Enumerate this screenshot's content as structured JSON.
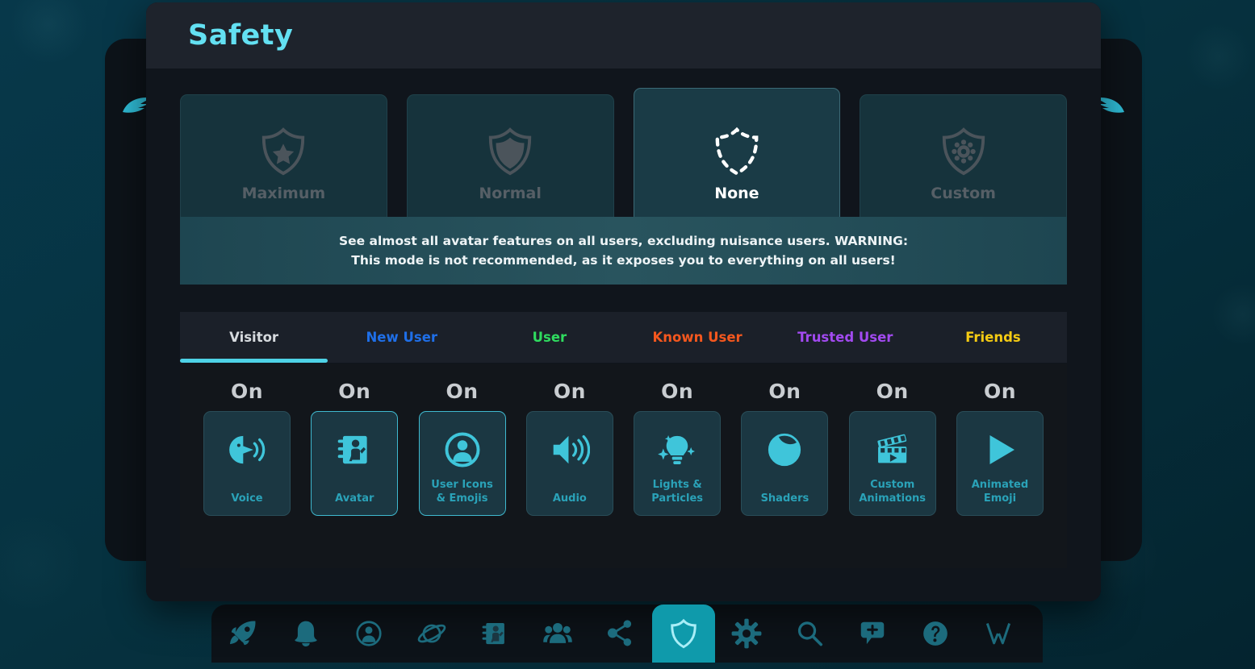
{
  "header": {
    "title": "Safety"
  },
  "colors": {
    "accent_cyan": "#63e0f2",
    "tile_icon": "#3fc5da",
    "tile_label": "#2aa2b8",
    "warning_text": "#eef4f6",
    "active_nav": "#0f9aab"
  },
  "safety_levels": [
    {
      "label": "Maximum",
      "icon": "shield-star-icon",
      "selected": false
    },
    {
      "label": "Normal",
      "icon": "shield-plain-icon",
      "selected": false
    },
    {
      "label": "None",
      "icon": "shield-dashed-icon",
      "selected": true
    },
    {
      "label": "Custom",
      "icon": "shield-gear-icon",
      "selected": false
    }
  ],
  "warning": {
    "line1": "See almost all avatar features on all users, excluding nuisance users. WARNING:",
    "line2": "This mode is not recommended, as it exposes you to everything on all users!"
  },
  "trust_tabs": [
    {
      "label": "Visitor",
      "color": "#d6dade",
      "active": true
    },
    {
      "label": "New User",
      "color": "#1f6fe8",
      "active": false
    },
    {
      "label": "User",
      "color": "#2fdb5f",
      "active": false
    },
    {
      "label": "Known User",
      "color": "#f4571e",
      "active": false
    },
    {
      "label": "Trusted User",
      "color": "#a24af0",
      "active": false
    },
    {
      "label": "Friends",
      "color": "#f5cb13",
      "active": false
    }
  ],
  "features": [
    {
      "state": "On",
      "label": "Voice",
      "icon": "voice-icon",
      "highlight": false
    },
    {
      "state": "On",
      "label": "Avatar",
      "icon": "avatar-book-icon",
      "highlight": true
    },
    {
      "state": "On",
      "label": "User Icons\n& Emojis",
      "icon": "user-circle-icon",
      "highlight": true
    },
    {
      "state": "On",
      "label": "Audio",
      "icon": "speaker-icon",
      "highlight": false
    },
    {
      "state": "On",
      "label": "Lights &\nParticles",
      "icon": "lightbulb-icon",
      "highlight": false
    },
    {
      "state": "On",
      "label": "Shaders",
      "icon": "orb-icon",
      "highlight": false
    },
    {
      "state": "On",
      "label": "Custom\nAnimations",
      "icon": "clapperboard-icon",
      "highlight": false
    },
    {
      "state": "On",
      "label": "Animated\nEmoji",
      "icon": "play-icon",
      "highlight": false
    }
  ],
  "bottom_nav": [
    {
      "icon": "rocket-icon",
      "active": false
    },
    {
      "icon": "bell-icon",
      "active": false
    },
    {
      "icon": "profile-icon",
      "active": false
    },
    {
      "icon": "planet-icon",
      "active": false
    },
    {
      "icon": "avatar-book-icon",
      "active": false
    },
    {
      "icon": "groups-icon",
      "active": false
    },
    {
      "icon": "social-graph-icon",
      "active": false
    },
    {
      "icon": "shield-icon",
      "active": true
    },
    {
      "icon": "gear-icon",
      "active": false
    },
    {
      "icon": "search-icon",
      "active": false
    },
    {
      "icon": "chat-plus-icon",
      "active": false
    },
    {
      "icon": "help-icon",
      "active": false
    },
    {
      "icon": "vrchat-logo-icon",
      "active": false
    }
  ]
}
